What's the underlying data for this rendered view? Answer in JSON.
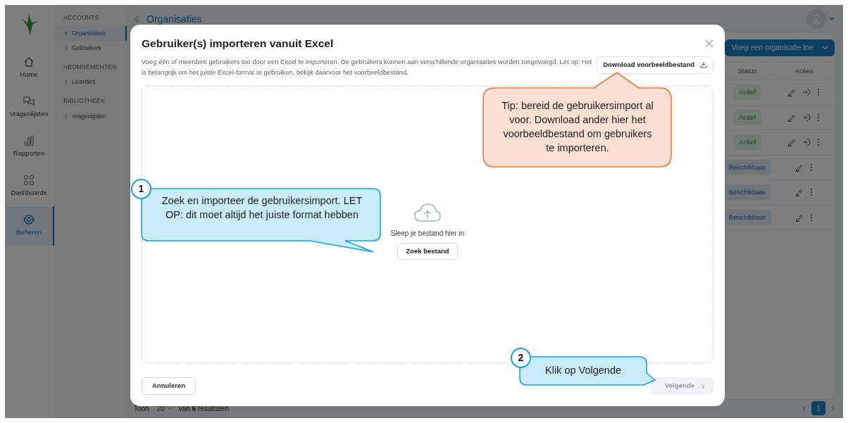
{
  "app_rail": {
    "items": [
      {
        "label": "Home",
        "selected": false
      },
      {
        "label": "Vragenlijsten",
        "selected": false
      },
      {
        "label": "Rapporten",
        "selected": false
      },
      {
        "label": "Dashboards",
        "selected": false
      },
      {
        "label": "Beheren",
        "selected": true
      }
    ]
  },
  "sidebar": {
    "sections": [
      {
        "title": "ACCOUNTS",
        "items": [
          {
            "label": "Organisaties",
            "selected": true
          },
          {
            "label": "Gebruikers",
            "selected": false
          }
        ]
      },
      {
        "title": "ABONNEMENTEN",
        "items": [
          {
            "label": "Licenties",
            "selected": false
          }
        ]
      },
      {
        "title": "BIBLIOTHEEK",
        "items": [
          {
            "label": "Vragenlijsten",
            "selected": false
          }
        ]
      }
    ]
  },
  "breadcrumb": "Organisaties",
  "toolbar": {
    "add_button": "Voeg een organisatie toe"
  },
  "table": {
    "columns": [
      "Status",
      "Acties"
    ],
    "rows": [
      {
        "kind": "active",
        "status": "Actief"
      },
      {
        "kind": "active",
        "status": "Actief"
      },
      {
        "kind": "active",
        "status": "Actief"
      },
      {
        "kind": "available",
        "status": "Beschikbaar"
      },
      {
        "kind": "available",
        "status": "Beschikbaar"
      },
      {
        "kind": "available",
        "status": "Beschikbaar"
      }
    ]
  },
  "footer": {
    "show_label": "Toon",
    "page_size": "20",
    "results": "van **6** resultaten"
  },
  "pagination": {
    "pages": [
      {
        "label": "1",
        "selected": true
      }
    ]
  },
  "dialog": {
    "title": "Gebruiker(s) importeren vanuit Excel",
    "description": "Voeg één of meerdere gebruikers toe door een Excel te importeren. De gebruikers kunnen aan verschillende organisaties worden toegevoegd. Let op: Het is belangrijk om het juiste Excel-format te gebruiken, bekijk daarvoor het voorbeeldbestand.",
    "download_button": "Download voorbeeldbestand",
    "dropzone": {
      "hint": "Sleep je bestand hier in",
      "browse_button": "Zoek bestand"
    },
    "cancel_button": "Annuleren",
    "next_button": {
      "label": "Volgende",
      "disabled": true
    }
  },
  "callouts": [
    {
      "kind": "tip",
      "text": "Tip: bereid de gebruikersimport al voor. Download ander hier het voorbeeldbestand om gebruikers te importeren."
    },
    {
      "kind": "step",
      "number": "1",
      "text": "Zoek en importeer de gebruikersimport. LET OP: dit moet altijd het juiste format hebben"
    },
    {
      "kind": "step",
      "number": "2",
      "text": "Klik op Volgende"
    }
  ]
}
